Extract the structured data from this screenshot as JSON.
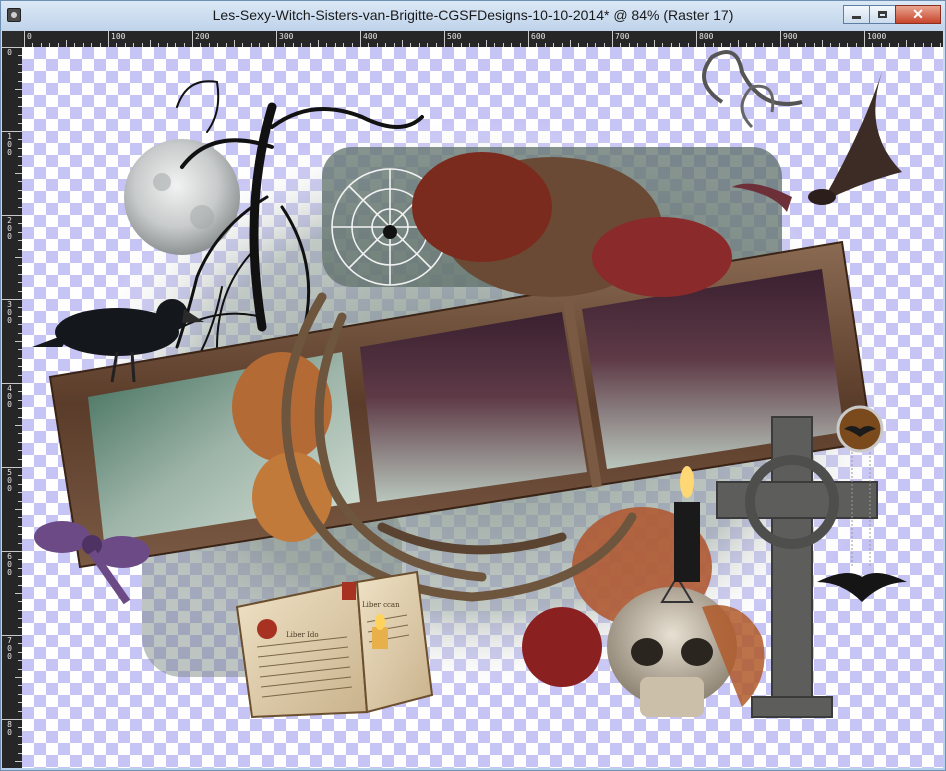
{
  "window": {
    "title": "Les-Sexy-Witch-Sisters-van-Brigitte-CGSFDesigns-10-10-2014* @  84% (Raster 17)",
    "controls": {
      "minimize": "minimize-icon",
      "maximize": "maximize-icon",
      "close": "close-icon"
    }
  },
  "ruler": {
    "top_labels": [
      "0",
      "100",
      "200",
      "300",
      "400",
      "500",
      "600",
      "700",
      "800",
      "900",
      "1000"
    ],
    "left_labels": [
      "0",
      "1 0 0",
      "2 0 0",
      "3 0 0",
      "4 0 0",
      "5 0 0",
      "6 0 0",
      "7 0 0",
      "8 0"
    ]
  },
  "canvas": {
    "transparency_checker_color": "#c6c3f5",
    "book_text": {
      "left_heading": "Liber Ido",
      "right_heading": "Liber ccan"
    }
  }
}
